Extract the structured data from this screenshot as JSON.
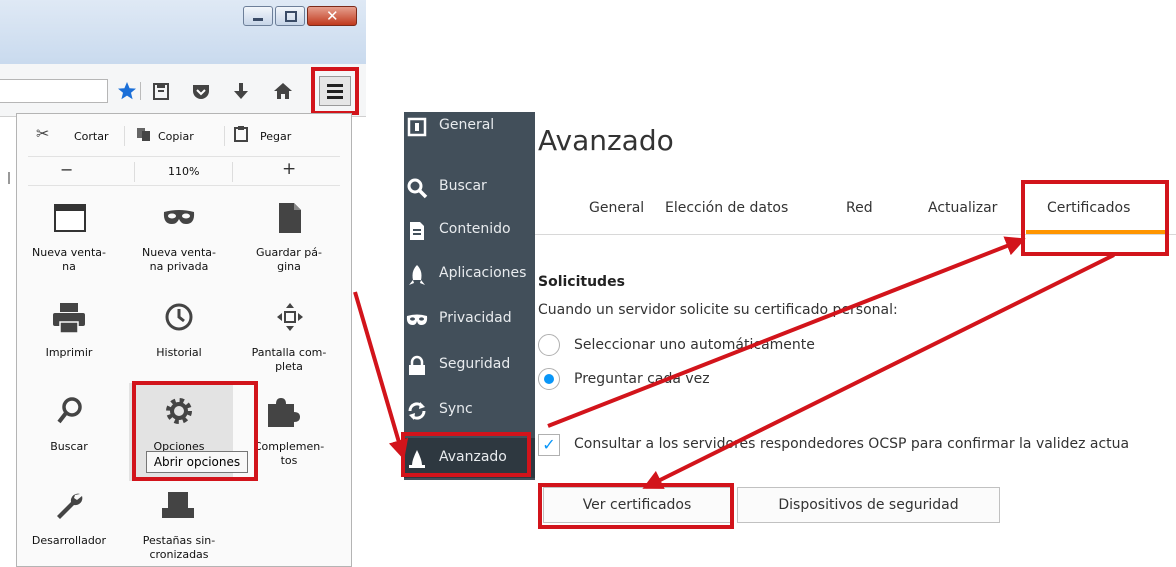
{
  "firefox_menu": {
    "edit": {
      "cut": "Cortar",
      "copy": "Copiar",
      "paste": "Pegar"
    },
    "zoom": {
      "out": "−",
      "level": "110%",
      "in": "+"
    },
    "tiles": [
      {
        "label_1": "Nueva venta-",
        "label_2": "na"
      },
      {
        "label_1": "Nueva venta-",
        "label_2": "na privada"
      },
      {
        "label_1": "Guardar pá-",
        "label_2": "gina"
      },
      {
        "label_1": "Imprimir",
        "label_2": ""
      },
      {
        "label_1": "Historial",
        "label_2": ""
      },
      {
        "label_1": "Pantalla com-",
        "label_2": "pleta"
      },
      {
        "label_1": "Buscar",
        "label_2": ""
      },
      {
        "label_1": "Opciones",
        "label_2": ""
      },
      {
        "label_1": "Complemen-",
        "label_2": "tos"
      },
      {
        "label_1": "Desarrollador",
        "label_2": ""
      },
      {
        "label_1": "Pestañas sin-",
        "label_2": "cronizadas"
      }
    ],
    "tooltip": "Abrir opciones"
  },
  "preferences": {
    "sidebar": [
      {
        "label": "General"
      },
      {
        "label": "Buscar"
      },
      {
        "label": "Contenido"
      },
      {
        "label": "Aplicaciones"
      },
      {
        "label": "Privacidad"
      },
      {
        "label": "Seguridad"
      },
      {
        "label": "Sync"
      },
      {
        "label": "Avanzado"
      }
    ],
    "title": "Avanzado",
    "tabs": [
      "General",
      "Elección de datos",
      "Red",
      "Actualizar",
      "Certificados"
    ],
    "section_title": "Solicitudes",
    "section_desc": "Cuando un servidor solicite su certificado personal:",
    "radio_1": "Seleccionar uno automáticamente",
    "radio_2": "Preguntar cada vez",
    "ocsp_checkbox": "Consultar a los servidores respondedores OCSP para confirmar la validez actua",
    "btn_view_certs": "Ver certificados",
    "btn_security_devices": "Dispositivos de seguridad"
  },
  "colors": {
    "highlight": "#d2141b",
    "accent_blue": "#0996f8",
    "sidebar": "#424f5a",
    "tab_underline": "#ff9500"
  }
}
